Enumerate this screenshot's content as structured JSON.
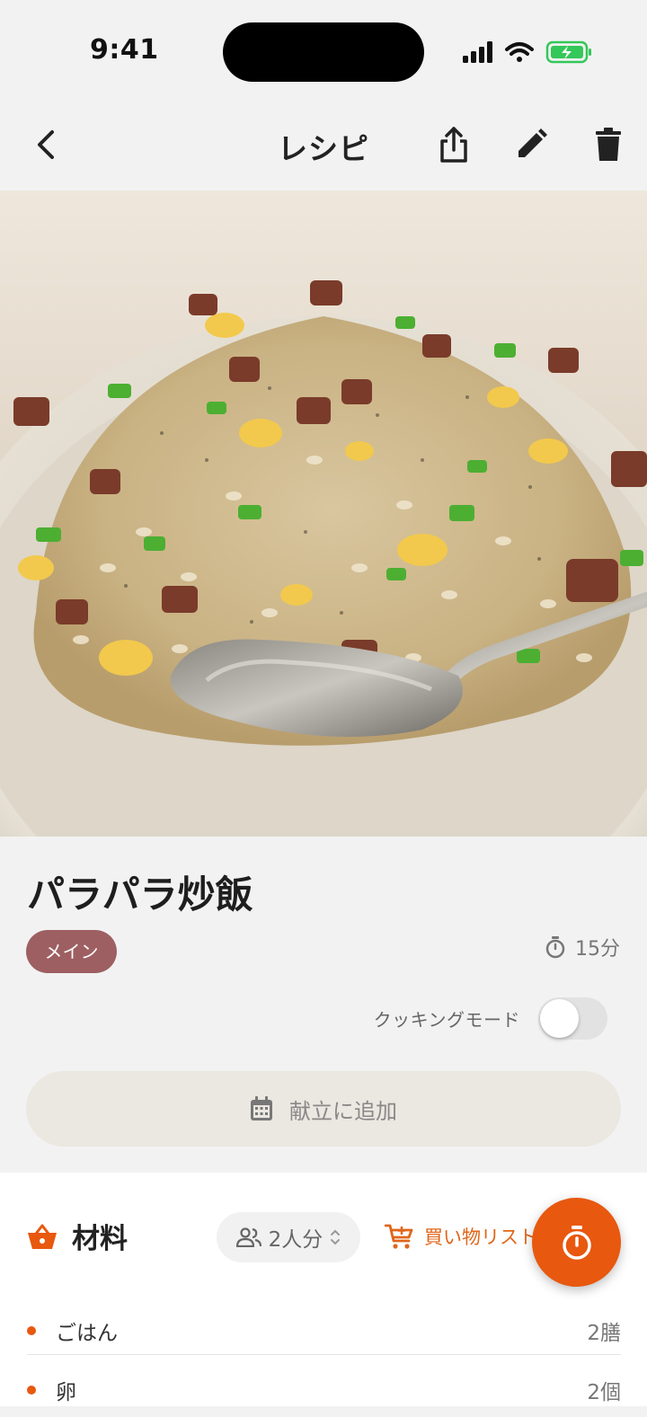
{
  "status_bar": {
    "time": "9:41"
  },
  "nav": {
    "title": "レシピ"
  },
  "recipe": {
    "title": "パラパラ炒飯",
    "category": "メイン",
    "cook_time": "15分",
    "cooking_mode_label": "クッキングモード",
    "cooking_mode_on": false,
    "add_to_menu_label": "献立に追加"
  },
  "ingredients": {
    "title": "材料",
    "servings": "2人分",
    "shopping_list_label": "買い物リスト",
    "items": [
      {
        "name": "ごはん",
        "amount": "2膳"
      },
      {
        "name": "卵",
        "amount": "2個"
      }
    ]
  },
  "colors": {
    "accent": "#e8580f",
    "tag": "#9e5f62",
    "battery": "#34c759"
  }
}
